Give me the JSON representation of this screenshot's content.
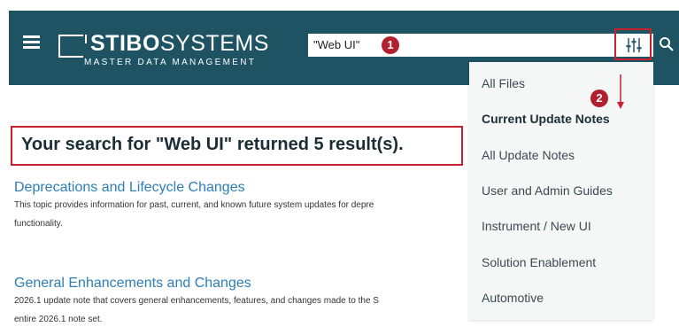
{
  "header": {
    "logo_bold": "STIBO",
    "logo_thin": "SYSTEMS",
    "logo_sub": "MASTER DATA MANAGEMENT"
  },
  "search": {
    "value": "\"Web UI\""
  },
  "callouts": {
    "one": "1",
    "two": "2"
  },
  "main": {
    "title": "Your search for \"Web UI\" returned 5 result(s).",
    "results": [
      {
        "title": "Deprecations and Lifecycle Changes",
        "line1": "This topic provides information for past, current, and known future system updates for depre",
        "line2": "functionality."
      },
      {
        "title": "General Enhancements and Changes",
        "line1": "2026.1 update note that covers general enhancements, features, and changes made to the S",
        "line2": "entire 2026.1 note set."
      }
    ]
  },
  "dropdown": {
    "items": [
      "All Files",
      "Current Update Notes",
      "All Update Notes",
      "User and Admin Guides",
      "Instrument / New UI",
      "Solution Enablement",
      "Automotive"
    ],
    "selected": "Current Update Notes"
  },
  "colors": {
    "header_bg": "#1d5363",
    "callout_red": "#c8202f",
    "link_blue": "#2d7fb5"
  }
}
